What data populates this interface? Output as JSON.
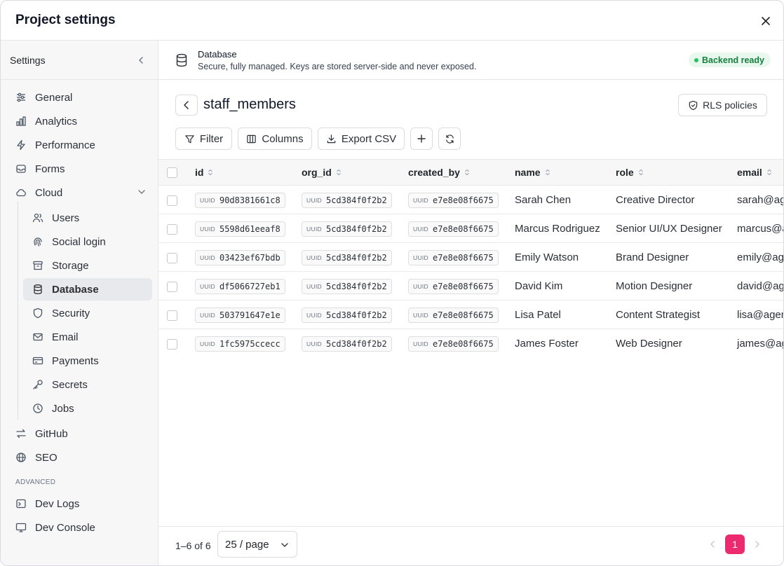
{
  "modal": {
    "title": "Project settings"
  },
  "sidebar": {
    "title": "Settings",
    "items": [
      {
        "label": "General",
        "icon": "sliders-icon"
      },
      {
        "label": "Analytics",
        "icon": "bar-chart-icon"
      },
      {
        "label": "Performance",
        "icon": "lightning-icon"
      },
      {
        "label": "Forms",
        "icon": "inbox-icon"
      },
      {
        "label": "Cloud",
        "icon": "cloud-icon"
      }
    ],
    "cloud_items": [
      {
        "label": "Users",
        "icon": "users-icon"
      },
      {
        "label": "Social login",
        "icon": "fingerprint-icon"
      },
      {
        "label": "Storage",
        "icon": "archive-icon"
      },
      {
        "label": "Database",
        "icon": "database-icon"
      },
      {
        "label": "Security",
        "icon": "shield-icon"
      },
      {
        "label": "Email",
        "icon": "mail-icon"
      },
      {
        "label": "Payments",
        "icon": "credit-card-icon"
      },
      {
        "label": "Secrets",
        "icon": "key-icon"
      },
      {
        "label": "Jobs",
        "icon": "clock-icon"
      }
    ],
    "more_items": [
      {
        "label": "GitHub",
        "icon": "git-icon"
      },
      {
        "label": "SEO",
        "icon": "globe-icon"
      }
    ],
    "advanced_label": "ADVANCED",
    "advanced_items": [
      {
        "label": "Dev Logs",
        "icon": "terminal-icon"
      },
      {
        "label": "Dev Console",
        "icon": "monitor-icon"
      }
    ]
  },
  "db_header": {
    "title": "Database",
    "subtitle": "Secure, fully managed. Keys are stored server-side and never exposed.",
    "status": "Backend ready",
    "status_color": "#22c55e"
  },
  "table_view": {
    "name": "staff_members",
    "rls_label": "RLS policies",
    "filter_label": "Filter",
    "columns_label": "Columns",
    "export_label": "Export CSV"
  },
  "grid": {
    "uuid_tag": "UUID",
    "headers": [
      "id",
      "org_id",
      "created_by",
      "name",
      "role",
      "email"
    ],
    "rows": [
      {
        "id": "90d8381661c8",
        "org_id": "5cd384f0f2b2",
        "created_by": "e7e8e08f6675",
        "name": "Sarah Chen",
        "role": "Creative Director",
        "email": "sarah@ag"
      },
      {
        "id": "5598d61eeaf8",
        "org_id": "5cd384f0f2b2",
        "created_by": "e7e8e08f6675",
        "name": "Marcus Rodriguez",
        "role": "Senior UI/UX Designer",
        "email": "marcus@a"
      },
      {
        "id": "03423ef67bdb",
        "org_id": "5cd384f0f2b2",
        "created_by": "e7e8e08f6675",
        "name": "Emily Watson",
        "role": "Brand Designer",
        "email": "emily@age"
      },
      {
        "id": "df5066727eb1",
        "org_id": "5cd384f0f2b2",
        "created_by": "e7e8e08f6675",
        "name": "David Kim",
        "role": "Motion Designer",
        "email": "david@age"
      },
      {
        "id": "503791647e1e",
        "org_id": "5cd384f0f2b2",
        "created_by": "e7e8e08f6675",
        "name": "Lisa Patel",
        "role": "Content Strategist",
        "email": "lisa@agen"
      },
      {
        "id": "1fc5975ccecc",
        "org_id": "5cd384f0f2b2",
        "created_by": "e7e8e08f6675",
        "name": "James Foster",
        "role": "Web Designer",
        "email": "james@ag"
      }
    ]
  },
  "footer": {
    "range": "1–6 of 6",
    "page_size": "25 / page",
    "current_page": "1",
    "accent": "#ec2a6e"
  }
}
